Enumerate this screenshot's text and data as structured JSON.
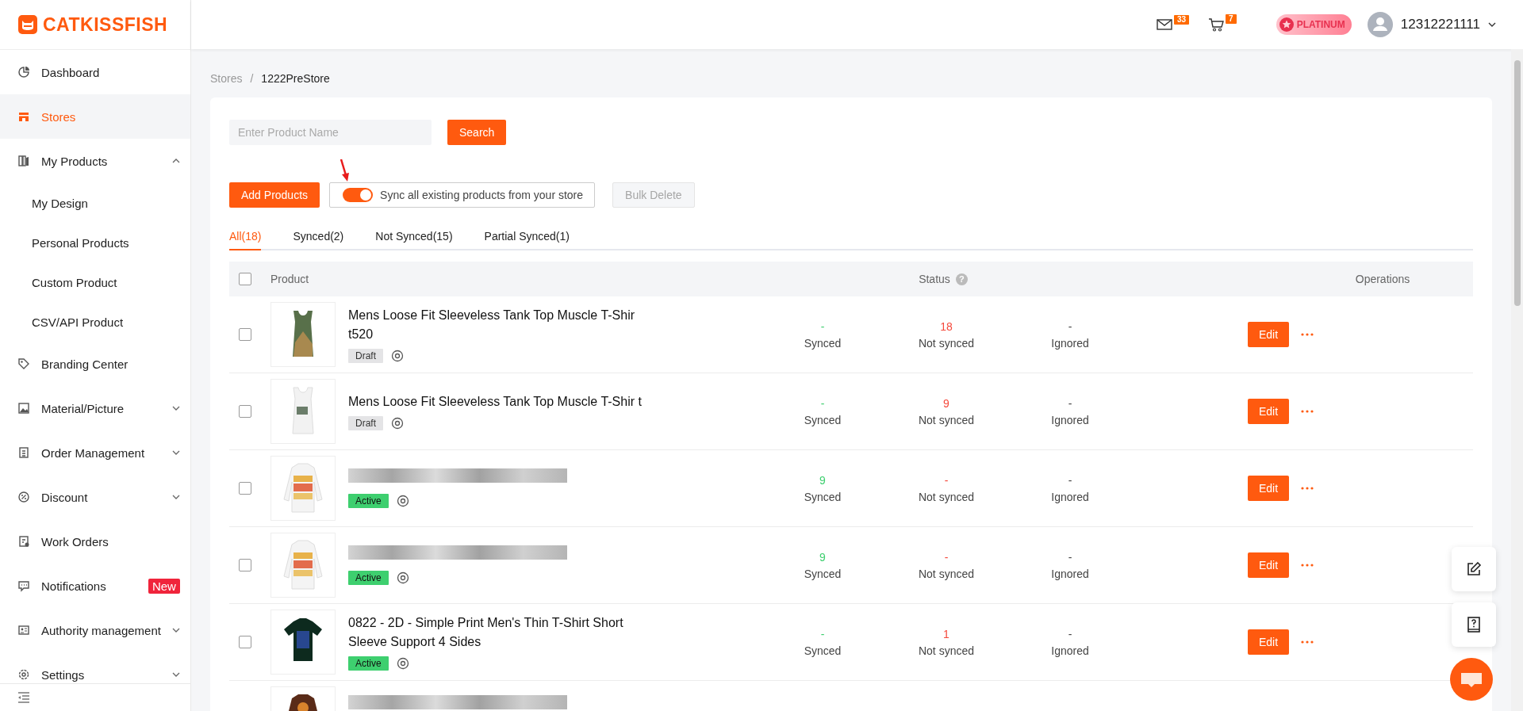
{
  "brand": {
    "name": "CATKISSFISH"
  },
  "sidebar": {
    "items": [
      {
        "label": "Dashboard",
        "selected": false
      },
      {
        "label": "Stores",
        "selected": true
      },
      {
        "label": "My Products",
        "selected": false,
        "expanded": true,
        "children": [
          {
            "label": "My Design",
            "selected": false
          },
          {
            "label": "Personal Products",
            "selected": false
          },
          {
            "label": "Custom Product",
            "selected": false
          },
          {
            "label": "CSV/API Product",
            "selected": false
          }
        ]
      },
      {
        "label": "Branding Center",
        "selected": false
      },
      {
        "label": "Material/Picture",
        "selected": false,
        "expanded": false
      },
      {
        "label": "Order Management",
        "selected": false,
        "expanded": false
      },
      {
        "label": "Discount",
        "selected": false,
        "expanded": false
      },
      {
        "label": "Work Orders",
        "selected": false
      },
      {
        "label": "Notifications",
        "selected": false,
        "badge": "New"
      },
      {
        "label": "Authority management",
        "selected": false,
        "expanded": false
      },
      {
        "label": "Settings",
        "selected": false,
        "expanded": false
      }
    ]
  },
  "header": {
    "mail_count": "33",
    "cart_count": "7",
    "plan": "PLATINUM",
    "user": "12312221111"
  },
  "breadcrumb": [
    {
      "label": "Stores",
      "current": false
    },
    {
      "label": "/",
      "current": false
    },
    {
      "label": "1222PreStore",
      "current": true
    }
  ],
  "search": {
    "placeholder": "Enter Product Name",
    "button": "Search"
  },
  "actions": {
    "add": "Add Products",
    "sync_label": "Sync all existing products from your store",
    "sync_on": true,
    "bulk_delete": "Bulk Delete",
    "bulk_disabled": true
  },
  "tabs": [
    {
      "label": "All(18)",
      "selected": true
    },
    {
      "label": "Synced(2)",
      "selected": false
    },
    {
      "label": "Not Synced(15)",
      "selected": false
    },
    {
      "label": "Partial Synced(1)",
      "selected": false
    }
  ],
  "table": {
    "all_checked": false,
    "columns": [
      "Product",
      "Status",
      "Operations"
    ],
    "status_help": "?",
    "rows": [
      {
        "checked": false,
        "name": "Mens Loose Fit Sleeveless Tank Top Muscle T-Shir t520",
        "name_blurred": false,
        "kind": "draft",
        "tag": "Draft",
        "synced": "-",
        "not_synced": "18",
        "ignored": "-",
        "synced_label": "Synced",
        "not_synced_label": "Not synced",
        "ignored_label": "Ignored",
        "edit": "Edit"
      },
      {
        "checked": false,
        "name": "Mens Loose Fit Sleeveless Tank Top Muscle T-Shir t",
        "name_blurred": false,
        "kind": "draft",
        "tag": "Draft",
        "synced": "-",
        "not_synced": "9",
        "ignored": "-",
        "synced_label": "Synced",
        "not_synced_label": "Not synced",
        "ignored_label": "Ignored",
        "edit": "Edit"
      },
      {
        "checked": false,
        "name_blurred": true,
        "kind": "active",
        "tag": "Active",
        "synced": "9",
        "not_synced": "-",
        "ignored": "-",
        "synced_label": "Synced",
        "not_synced_label": "Not synced",
        "ignored_label": "Ignored",
        "edit": "Edit"
      },
      {
        "checked": false,
        "name_blurred": true,
        "kind": "active",
        "tag": "Active",
        "synced": "9",
        "not_synced": "-",
        "ignored": "-",
        "synced_label": "Synced",
        "not_synced_label": "Not synced",
        "ignored_label": "Ignored",
        "edit": "Edit"
      },
      {
        "checked": false,
        "name": "0822 - 2D - Simple Print Men's Thin T-Shirt Short Sleeve Support 4 Sides",
        "name_blurred": false,
        "kind": "active",
        "tag": "Active",
        "synced": "-",
        "not_synced": "1",
        "ignored": "-",
        "synced_label": "Synced",
        "not_synced_label": "Not synced",
        "ignored_label": "Ignored",
        "edit": "Edit"
      },
      {
        "name_blurred": true
      }
    ]
  }
}
